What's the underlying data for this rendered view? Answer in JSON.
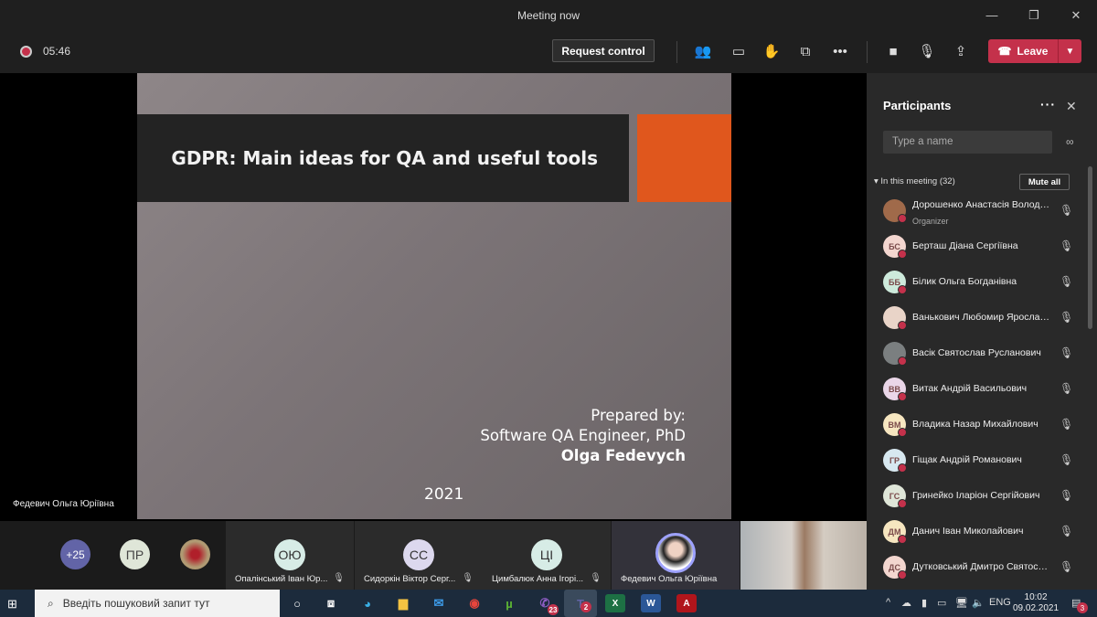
{
  "window": {
    "title": "Meeting now"
  },
  "toolbar": {
    "timer": "05:46",
    "request_control": "Request control",
    "leave": "Leave"
  },
  "slide": {
    "title": "GDPR: Main ideas for QA and useful tools",
    "prepared_by": "Prepared by:",
    "role": "Software QA Engineer, PhD",
    "author": "Olga Fedevych",
    "year": "2021",
    "accent": "#e0571d"
  },
  "stage": {
    "presenter_name": "Федевич Ольга Юріївна"
  },
  "strip": {
    "overflow": "+25",
    "initials_pr": "ПР",
    "tiles": [
      {
        "initials": "ОЮ",
        "name": "Опалінський Іван Юр..."
      },
      {
        "initials": "СС",
        "name": "Сидоркін Віктор Серг..."
      },
      {
        "initials": "ЦІ",
        "name": "Цимбалюк Анна Ігорі..."
      },
      {
        "name": "Федевич Ольга Юріївна"
      }
    ]
  },
  "participants": {
    "title": "Participants",
    "search_placeholder": "Type a name",
    "section": "In this meeting (32)",
    "mute_all": "Mute all",
    "list": [
      {
        "name": "Дорошенко Анастасія Володимирівна",
        "role": "Organizer",
        "initials": "",
        "color": "#a06a4a"
      },
      {
        "name": "Берташ Діана Сергіївна",
        "initials": "БС",
        "color": "#f3d6cf"
      },
      {
        "name": "Білик Ольга Богданівна",
        "initials": "ББ",
        "color": "#cdeadb"
      },
      {
        "name": "Ванькович Любомир Ярославович",
        "initials": "",
        "color": "#e9d4c8"
      },
      {
        "name": "Васік Святослав Русланович",
        "initials": "",
        "color": "#7b7f80"
      },
      {
        "name": "Витак Андрій Васильович",
        "initials": "ВВ",
        "color": "#ead6e8"
      },
      {
        "name": "Владика Назар Михайлович",
        "initials": "ВМ",
        "color": "#f6e6c0"
      },
      {
        "name": "Гіщак Андрій Романович",
        "initials": "ГР",
        "color": "#d7e8f0"
      },
      {
        "name": "Гринейко Іларіон Сергійович",
        "initials": "ГС",
        "color": "#dfe6d8"
      },
      {
        "name": "Данич Іван Миколайович",
        "initials": "ДМ",
        "color": "#f6e6c0"
      },
      {
        "name": "Дутковський Дмитро Святославович",
        "initials": "ДС",
        "color": "#f3d6cf"
      }
    ]
  },
  "taskbar": {
    "search_placeholder": "Введіть пошуковий запит тут",
    "viber_badge": "23",
    "teams_badge": "2",
    "lang": "ENG",
    "time": "10:02",
    "date": "09.02.2021",
    "notifications": "3"
  }
}
